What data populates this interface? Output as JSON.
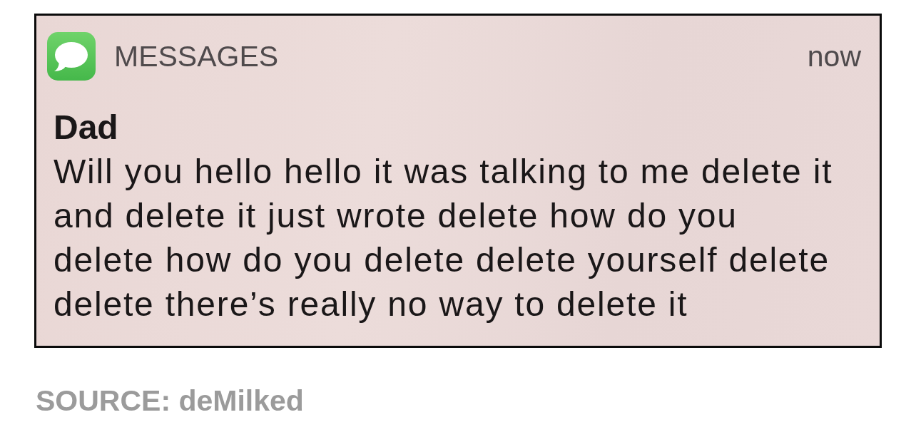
{
  "notification": {
    "app_name": "MESSAGES",
    "time": "now",
    "sender": "Dad",
    "message": "Will you hello hello it was talking to me delete it\nand delete it just wrote delete how do you\ndelete how do you delete delete yourself delete\ndelete there’s really no way to delete it"
  },
  "caption": "SOURCE: deMilked"
}
